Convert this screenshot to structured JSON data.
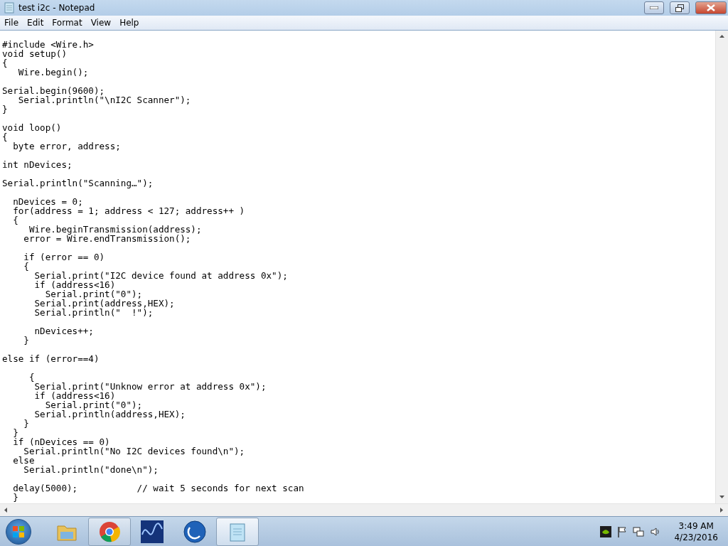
{
  "window": {
    "title": "test i2c - Notepad"
  },
  "menu": [
    "File",
    "Edit",
    "Format",
    "View",
    "Help"
  ],
  "editor": {
    "text": "\n#include <Wire.h>\nvoid setup()\n{\n   Wire.begin();\n\nSerial.begin(9600);\n   Serial.println(\"\\nI2C Scanner\");\n}\n\nvoid loop()\n{\n  byte error, address;\n\nint nDevices;\n\nSerial.println(\"Scanning…\");\n\n  nDevices = 0;\n  for(address = 1; address < 127; address++ )\n  {\n     Wire.beginTransmission(address);\n    error = Wire.endTransmission();\n\n    if (error == 0)\n    {\n      Serial.print(\"I2C device found at address 0x\");\n      if (address<16)\n        Serial.print(\"0\");\n      Serial.print(address,HEX);\n      Serial.println(\"  !\");\n\n      nDevices++;\n    }\n\nelse if (error==4)\n\n     {\n      Serial.print(\"Unknow error at address 0x\");\n      if (address<16)\n        Serial.print(\"0\");\n      Serial.println(address,HEX);\n    }\n  }\n  if (nDevices == 0)\n    Serial.println(\"No I2C devices found\\n\");\n  else\n    Serial.println(\"done\\n\");\n\n  delay(5000);           // wait 5 seconds for next scan\n  }"
  },
  "taskbar": {
    "apps": [
      {
        "kind": "folder",
        "running": false,
        "selected": false
      },
      {
        "kind": "browser",
        "running": true,
        "selected": false
      },
      {
        "kind": "wave",
        "running": false,
        "selected": false
      },
      {
        "kind": "circle",
        "running": false,
        "selected": false
      },
      {
        "kind": "notepad",
        "running": true,
        "selected": true
      }
    ],
    "tray": [
      {
        "kind": "gpu"
      },
      {
        "kind": "flag"
      },
      {
        "kind": "network"
      },
      {
        "kind": "volume"
      }
    ],
    "time": "3:49 AM",
    "date": "4/23/2016"
  }
}
